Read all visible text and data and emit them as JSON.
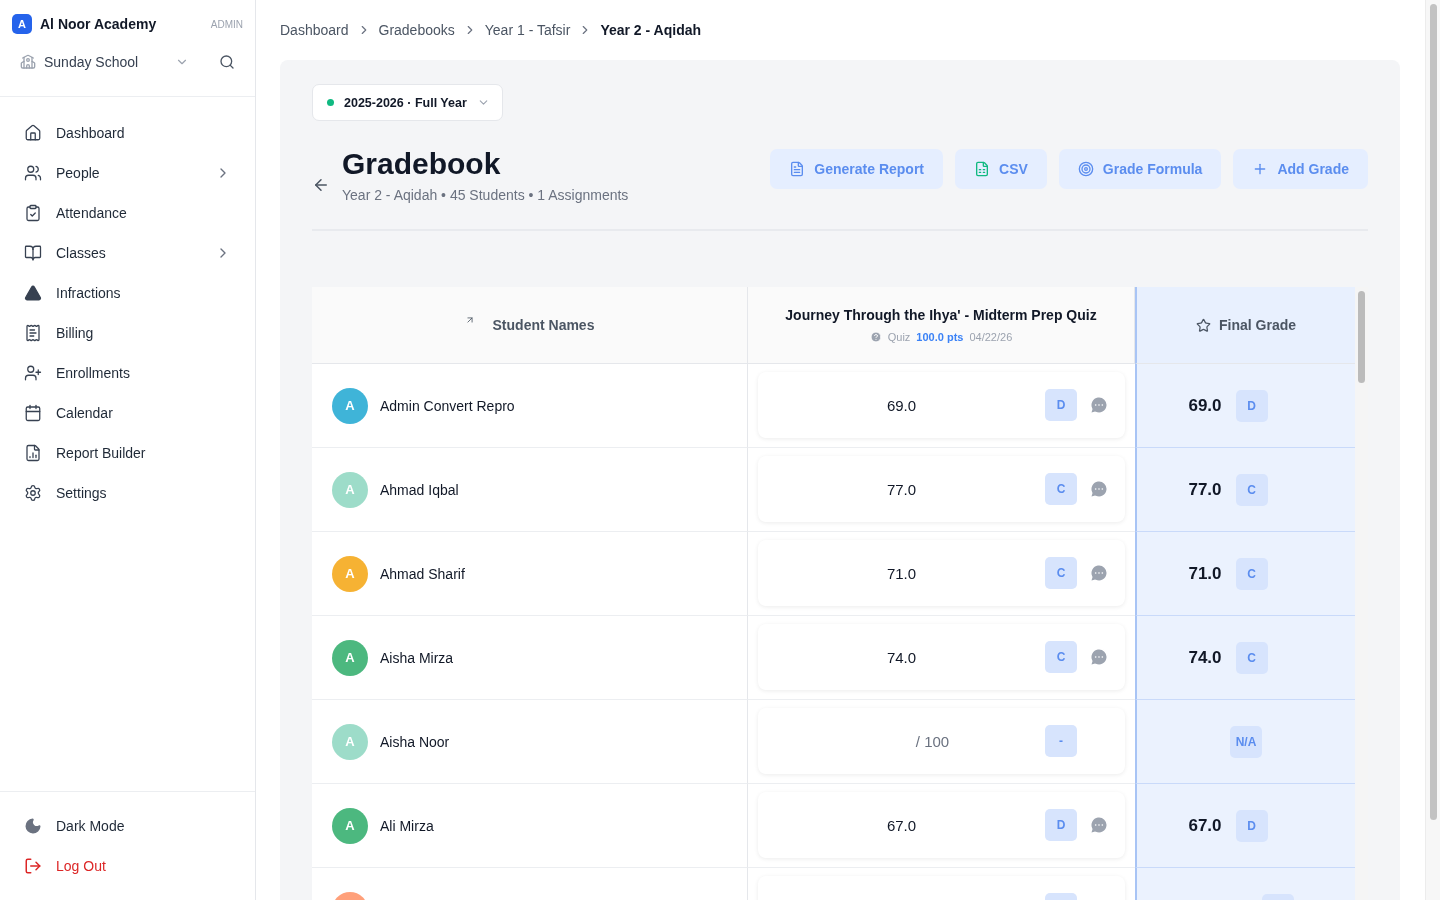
{
  "sidebar": {
    "org": {
      "initial": "A",
      "name": "Al Noor Academy",
      "role": "ADMIN"
    },
    "school": {
      "name": "Sunday School"
    },
    "items": [
      {
        "label": "Dashboard",
        "has_submenu": false
      },
      {
        "label": "People",
        "has_submenu": true
      },
      {
        "label": "Attendance",
        "has_submenu": false
      },
      {
        "label": "Classes",
        "has_submenu": true
      },
      {
        "label": "Infractions",
        "has_submenu": false
      },
      {
        "label": "Billing",
        "has_submenu": false
      },
      {
        "label": "Enrollments",
        "has_submenu": false
      },
      {
        "label": "Calendar",
        "has_submenu": false
      },
      {
        "label": "Report Builder",
        "has_submenu": false
      },
      {
        "label": "Settings",
        "has_submenu": false
      }
    ],
    "footer": [
      {
        "label": "Dark Mode",
        "kind": "theme"
      },
      {
        "label": "Log Out",
        "kind": "logout"
      }
    ]
  },
  "breadcrumbs": [
    "Dashboard",
    "Gradebooks",
    "Year 1 - Tafsir",
    "Year 2 - Aqidah"
  ],
  "term": {
    "label": "2025-2026 · Full Year",
    "color": "#10b981"
  },
  "header": {
    "title": "Gradebook",
    "subtitle": "Year 2 - Aqidah • 45 Students • 1 Assignments"
  },
  "actions": [
    {
      "label": "Generate Report"
    },
    {
      "label": "CSV"
    },
    {
      "label": "Grade Formula"
    },
    {
      "label": "Add Grade"
    }
  ],
  "table": {
    "name_column": "Student Names",
    "assignment": {
      "title": "Journey Through the Ihya' - Midterm Prep Quiz",
      "type": "Quiz",
      "points": "100.0 pts",
      "date": "04/22/26"
    },
    "final_column": "Final Grade",
    "rows": [
      {
        "initial": "A",
        "name": "Admin Convert Repro",
        "color": "#3fb4d8",
        "score": {
          "kind": "graded",
          "value": "69.0",
          "letter": "D",
          "comment": true
        },
        "final": {
          "value": "69.0",
          "letter": "D"
        }
      },
      {
        "initial": "A",
        "name": "Ahmad Iqbal",
        "color": "#9ddcc9",
        "score": {
          "kind": "graded",
          "value": "77.0",
          "letter": "C",
          "comment": true
        },
        "final": {
          "value": "77.0",
          "letter": "C"
        }
      },
      {
        "initial": "A",
        "name": "Ahmad Sharif",
        "color": "#f6b233",
        "score": {
          "kind": "graded",
          "value": "71.0",
          "letter": "C",
          "comment": true
        },
        "final": {
          "value": "71.0",
          "letter": "C"
        }
      },
      {
        "initial": "A",
        "name": "Aisha Mirza",
        "color": "#4cb87f",
        "score": {
          "kind": "graded",
          "value": "74.0",
          "letter": "C",
          "comment": true
        },
        "final": {
          "value": "74.0",
          "letter": "C"
        }
      },
      {
        "initial": "A",
        "name": "Aisha Noor",
        "color": "#9ddcc9",
        "score": {
          "kind": "empty",
          "value": "/ 100",
          "letter": "-",
          "comment": false
        },
        "final": {
          "letter": "N/A"
        }
      },
      {
        "initial": "A",
        "name": "Ali Mirza",
        "color": "#4cb87f",
        "score": {
          "kind": "graded",
          "value": "67.0",
          "letter": "D",
          "comment": true
        },
        "final": {
          "value": "67.0",
          "letter": "D"
        }
      },
      {
        "color": "#ffa07a",
        "score": {
          "kind": "cut"
        },
        "final": {}
      }
    ]
  }
}
